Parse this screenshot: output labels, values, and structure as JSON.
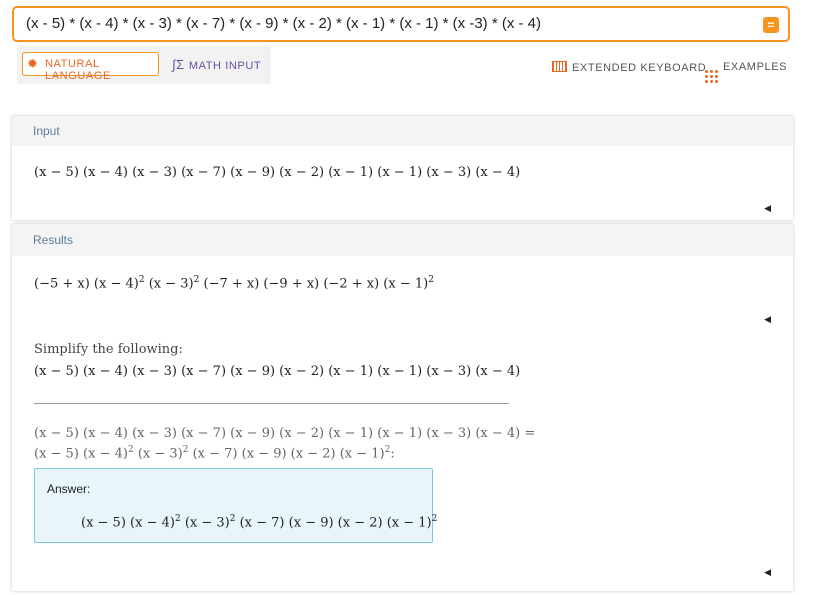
{
  "search": {
    "query": "(x - 5) * (x - 4) * (x - 3) * (x - 7) * (x - 9) * (x - 2) * (x - 1) * (x - 1) * (x -3) * (x - 4)",
    "equals_icon": "equals-icon"
  },
  "modes": {
    "natural_language": "NATURAL LANGUAGE",
    "math_input": "MATH INPUT"
  },
  "top_links": {
    "extended_keyboard": "EXTENDED KEYBOARD",
    "examples": "EXAMPLES"
  },
  "input_pod": {
    "title": "Input",
    "expression": "(x − 5) (x − 4) (x − 3) (x − 7) (x − 9) (x − 2) (x − 1) (x − 1) (x − 3) (x − 4)"
  },
  "results_pod": {
    "title": "Results",
    "result_1": {
      "before_a": "(−5 + x) (x − 4)",
      "exp_a": "2",
      "before_b": " (x − 3)",
      "exp_b": "2",
      "before_c": " (−7 + x) (−9 + x) (−2 + x) (x − 1)",
      "exp_c": "2"
    },
    "step_heading": "Simplify the following:",
    "step_expression": "(x − 5) (x − 4) (x − 3) (x − 7) (x − 9) (x − 2) (x − 1) (x − 1) (x − 3) (x − 4)",
    "step_line_1": "(x − 5) (x − 4) (x − 3) (x − 7) (x − 9) (x − 2) (x − 1) (x − 1) (x − 3) (x − 4) =",
    "step_line_2": {
      "a": "(x − 5) (x − 4)",
      "exp_a": "2",
      "b": " (x − 3)",
      "exp_b": "2",
      "c": " (x − 7) (x − 9) (x − 2) (x − 1)",
      "exp_c": "2",
      "d": ":"
    },
    "answer_label": "Answer:",
    "answer": {
      "a": "(x − 5) (x − 4)",
      "exp_a": "2",
      "b": " (x − 3)",
      "exp_b": "2",
      "c": " (x − 7) (x − 9) (x − 2) (x − 1)",
      "exp_c": "2"
    }
  },
  "colors": {
    "accent": "#f7941d",
    "math_input": "#6b4ea3",
    "pod_title": "#5b7e9c",
    "answer_border": "#7bc9e0",
    "answer_bg": "#e8f6fb"
  }
}
